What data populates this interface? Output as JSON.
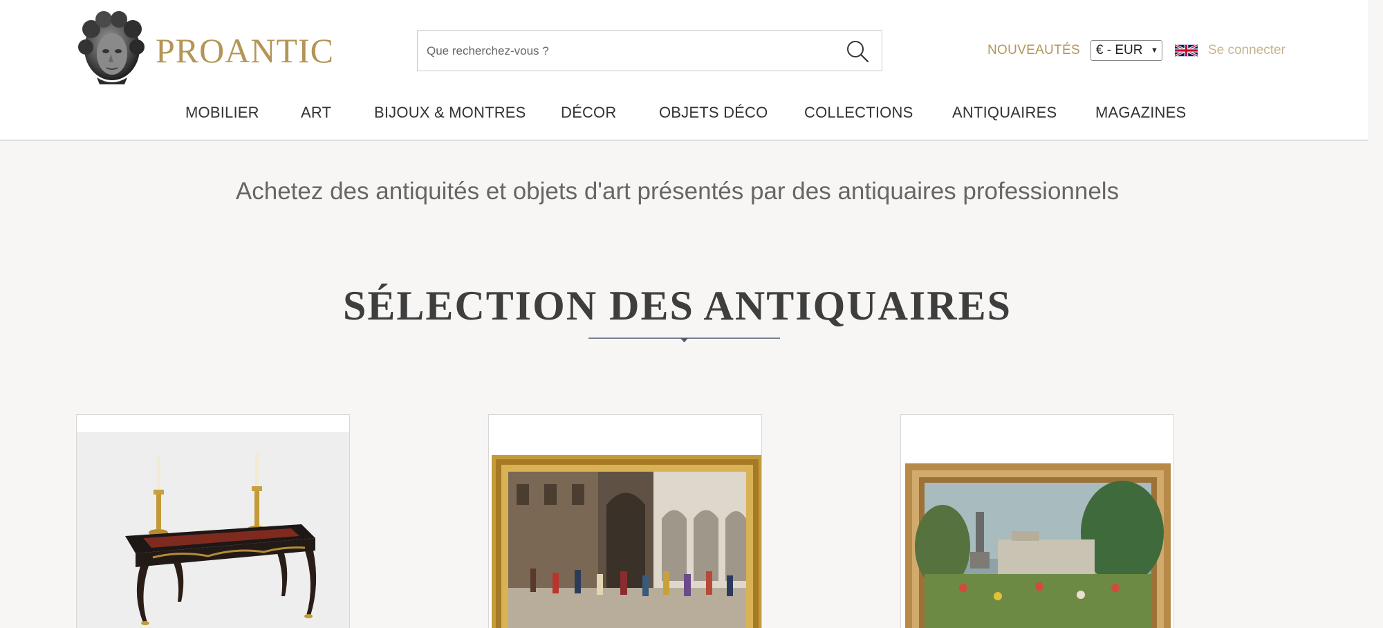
{
  "brand": {
    "name": "PROANTIC"
  },
  "search": {
    "placeholder": "Que recherchez-vous ?"
  },
  "top_links": {
    "new_label": "NOUVEAUTÉS",
    "currency": "€ - EUR",
    "login_label": "Se connecter"
  },
  "nav": {
    "items": [
      {
        "label": "MOBILIER"
      },
      {
        "label": "ART"
      },
      {
        "label": "BIJOUX & MONTRES"
      },
      {
        "label": "DÉCOR"
      },
      {
        "label": "OBJETS DÉCO"
      },
      {
        "label": "COLLECTIONS"
      },
      {
        "label": "ANTIQUAIRES"
      },
      {
        "label": "MAGAZINES"
      }
    ]
  },
  "main": {
    "tagline": "Achetez des antiquités et objets d'art présentés par des antiquaires professionnels",
    "section_title": "SÉLECTION DES ANTIQUAIRES"
  },
  "colors": {
    "brand_gold": "#b39556",
    "background": "#f7f6f4",
    "header_bg": "#ffffff"
  },
  "icons": {
    "search": "search-icon",
    "flag": "uk-flag-icon",
    "logo": "logo-head-icon"
  }
}
